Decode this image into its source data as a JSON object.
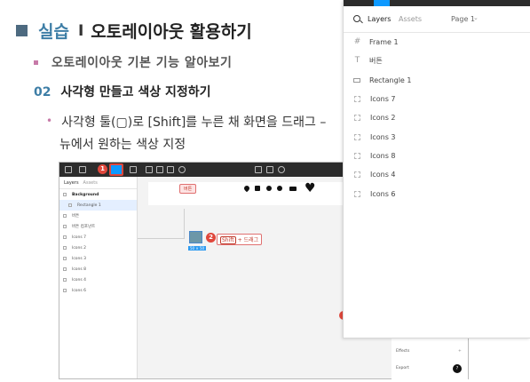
{
  "slide": {
    "title_main": "실습",
    "title_sep": "I",
    "title_sub": "오토레이아웃 활용하기",
    "subtitle": "오토레이아웃 기본 기능 알아보기",
    "section_num": "02",
    "section_title": "사각형 만들고 색상 지정하기",
    "bullet_line1": "사각형 툴(▢)로 [Shift]를 누른 채 화면을 드래그 –",
    "bullet_line2": "뉴에서 원하는 색상 지정"
  },
  "screenshot": {
    "badge1": "1",
    "badge2": "2",
    "layers_tab": "Layers",
    "assets_tab": "Assets",
    "layers": [
      {
        "name": "Background",
        "kind": "frame"
      },
      {
        "name": "Rectangle 1",
        "kind": "rect"
      },
      {
        "name": "버튼",
        "kind": "text"
      },
      {
        "name": "버튼 컴포넌트",
        "kind": "text"
      },
      {
        "name": "Icons 7",
        "kind": "icon"
      },
      {
        "name": "Icons 2",
        "kind": "icon"
      },
      {
        "name": "Icons 3",
        "kind": "icon"
      },
      {
        "name": "Icons 8",
        "kind": "icon"
      },
      {
        "name": "Icons 4",
        "kind": "icon"
      },
      {
        "name": "Icons 6",
        "kind": "icon"
      }
    ],
    "canvas_button": "버튼",
    "size_label": "50 × 50",
    "drag_key": "Shift",
    "drag_text": "+ 드래그",
    "props_effects": "Effects",
    "props_effects_plus": "+",
    "props_export": "Export",
    "help": "?"
  },
  "panel": {
    "tab_layers": "Layers",
    "tab_assets": "Assets",
    "page": "Page 1",
    "layers": [
      {
        "name": "Frame 1",
        "icon": "frame-icon"
      },
      {
        "name": "버튼",
        "icon": "text-icon"
      },
      {
        "name": "Rectangle 1",
        "icon": "rectangle-icon"
      },
      {
        "name": "Icons 7",
        "icon": "component-icon"
      },
      {
        "name": "Icons 2",
        "icon": "component-icon"
      },
      {
        "name": "Icons 3",
        "icon": "component-icon"
      },
      {
        "name": "Icons 8",
        "icon": "component-icon"
      },
      {
        "name": "Icons 4",
        "icon": "component-icon"
      },
      {
        "name": "Icons 6",
        "icon": "component-icon"
      }
    ]
  }
}
